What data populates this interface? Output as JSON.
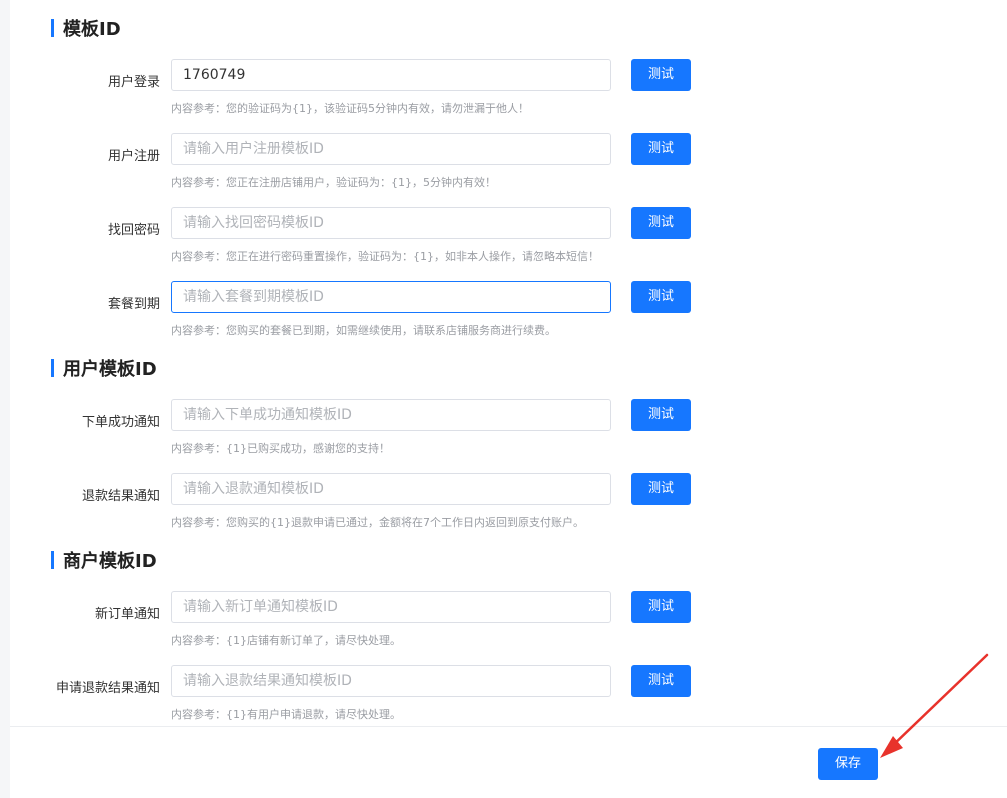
{
  "sections": {
    "template": "模板ID",
    "user_template": "用户模板ID",
    "merchant_template": "商户模板ID"
  },
  "fields": [
    {
      "label": "用户登录",
      "value": "1760749",
      "placeholder": "",
      "hint": "内容参考：您的验证码为{1}，该验证码5分钟内有效，请勿泄漏于他人！",
      "button": "测试"
    },
    {
      "label": "用户注册",
      "value": "",
      "placeholder": "请输入用户注册模板ID",
      "hint": "内容参考：您正在注册店铺用户，验证码为：{1}，5分钟内有效！",
      "button": "测试"
    },
    {
      "label": "找回密码",
      "value": "",
      "placeholder": "请输入找回密码模板ID",
      "hint": "内容参考：您正在进行密码重置操作，验证码为：{1}，如非本人操作，请忽略本短信！",
      "button": "测试"
    },
    {
      "label": "套餐到期",
      "value": "",
      "placeholder": "请输入套餐到期模板ID",
      "hint": "内容参考：您购买的套餐已到期，如需继续使用，请联系店铺服务商进行续费。",
      "button": "测试"
    },
    {
      "label": "下单成功通知",
      "value": "",
      "placeholder": "请输入下单成功通知模板ID",
      "hint": "内容参考：{1}已购买成功，感谢您的支持！",
      "button": "测试"
    },
    {
      "label": "退款结果通知",
      "value": "",
      "placeholder": "请输入退款通知模板ID",
      "hint": "内容参考：您购买的{1}退款申请已通过，金额将在7个工作日内返回到原支付账户。",
      "button": "测试"
    },
    {
      "label": "新订单通知",
      "value": "",
      "placeholder": "请输入新订单通知模板ID",
      "hint": "内容参考：{1}店铺有新订单了，请尽快处理。",
      "button": "测试"
    },
    {
      "label": "申请退款结果通知",
      "value": "",
      "placeholder": "请输入退款结果通知模板ID",
      "hint": "内容参考：{1}有用户申请退款，请尽快处理。",
      "button": "测试"
    }
  ],
  "footer": {
    "save_label": "保存"
  },
  "colors": {
    "accent": "#1677ff",
    "arrow": "#e8322b"
  }
}
